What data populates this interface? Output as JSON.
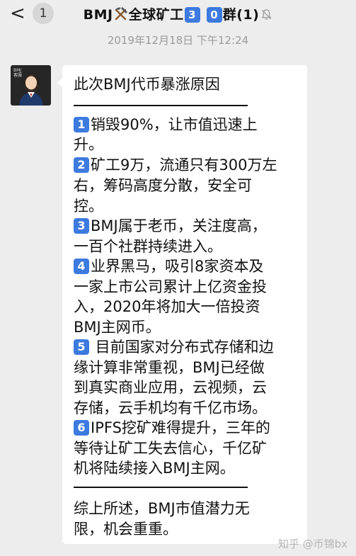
{
  "header": {
    "back_chevron": "<",
    "back_count": "1",
    "group_name_prefix": "BMJ",
    "group_icon": "hammer-pick-icon",
    "group_name_mid": "全球矿工",
    "group_key_1": "3",
    "group_key_2": "0",
    "group_name_suffix": "群(1)",
    "mute_icon": "bell-muted-icon"
  },
  "timestamp": "2019年12月18日 下午12:24",
  "sender": {
    "avatar_text": "BMJ\n客服"
  },
  "message": {
    "title": "此次BMJ代币暴涨原因",
    "items": [
      {
        "num": "1",
        "lines": [
          "销毁90%，让市值迅速上",
          "升。"
        ]
      },
      {
        "num": "2",
        "lines": [
          "矿工9万，流通只有300万左",
          "右，筹码高度分散，安全可",
          "控。"
        ]
      },
      {
        "num": "3",
        "lines": [
          "BMJ属于老币，关注度高，",
          "一百个社群持续进入。"
        ]
      },
      {
        "num": "4",
        "lines": [
          "业界黑马，吸引8家资本及",
          "一家上市公司累计上亿资金投",
          "入，2020年将加大一倍投资",
          "BMJ主网币。"
        ]
      },
      {
        "num": "5",
        "lines": [
          " 目前国家对分布式存储和边",
          "缘计算非常重视，BMJ已经做",
          "到真实商业应用，云视频，云",
          "存储，云手机均有千亿市场。"
        ]
      },
      {
        "num": "6",
        "lines": [
          "IPFS挖矿难得提升，三年的",
          "等待让矿工失去信心，千亿矿",
          "机将陆续接入BMJ主网。"
        ]
      }
    ],
    "conclusion": [
      "综上所述，BMJ市值潜力无",
      "限，机会重重。"
    ]
  },
  "watermark": "知乎 @币锦bx",
  "colors": {
    "background": "#ededed",
    "bubble": "#ffffff",
    "keycap_blue": "#3d7ae0",
    "timestamp_gray": "#9a9a9a"
  }
}
